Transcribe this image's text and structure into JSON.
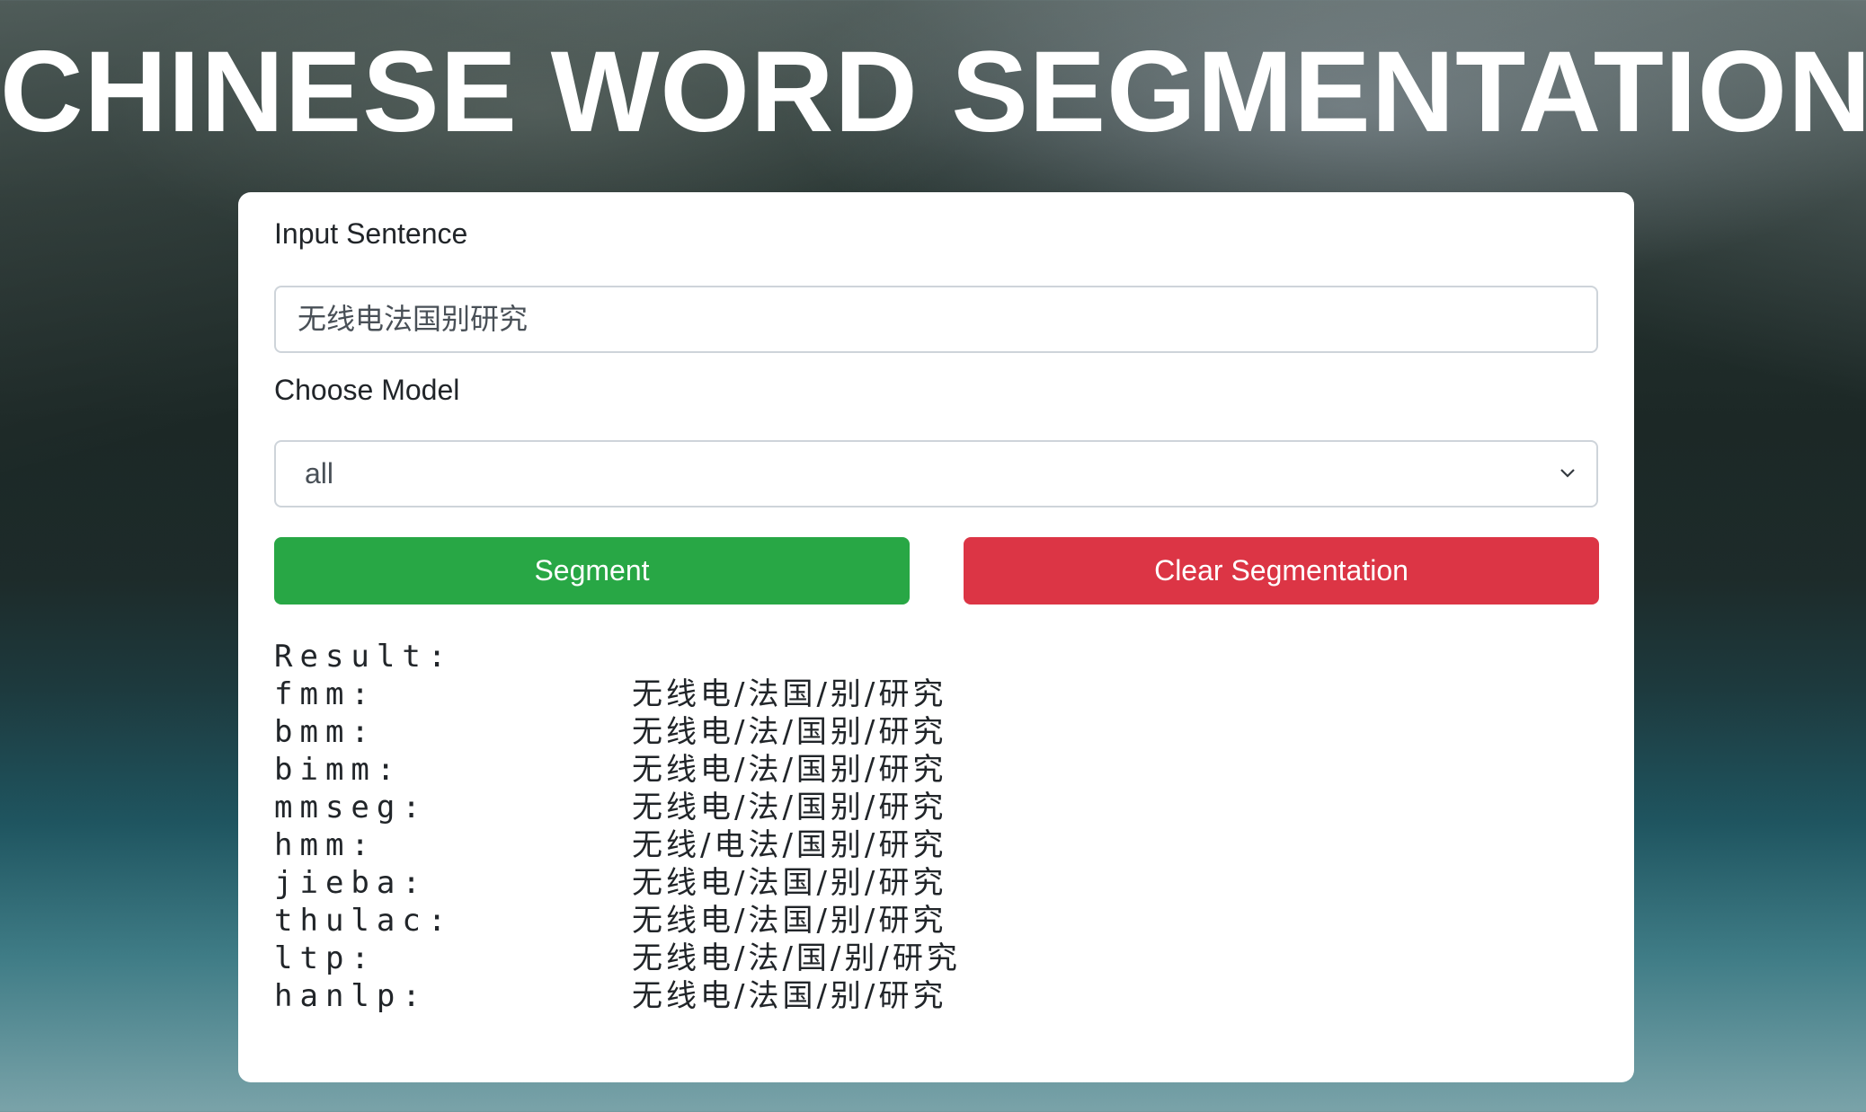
{
  "header": {
    "title": "CHINESE WORD SEGMENTATION"
  },
  "form": {
    "input_label": "Input Sentence",
    "input_value": "无线电法国别研究",
    "model_label": "Choose Model",
    "model_selected": "all",
    "segment_button": "Segment",
    "clear_button": "Clear Segmentation"
  },
  "result": {
    "heading": "Result:",
    "rows": [
      {
        "model": "fmm:",
        "segmentation": "无线电/法国/别/研究"
      },
      {
        "model": "bmm:",
        "segmentation": "无线电/法/国别/研究"
      },
      {
        "model": "bimm:",
        "segmentation": "无线电/法/国别/研究"
      },
      {
        "model": "mmseg:",
        "segmentation": "无线电/法/国别/研究"
      },
      {
        "model": "hmm:",
        "segmentation": "无线/电法/国别/研究"
      },
      {
        "model": "jieba:",
        "segmentation": "无线电/法国/别/研究"
      },
      {
        "model": "thulac:",
        "segmentation": "无线电/法国/别/研究"
      },
      {
        "model": "ltp:",
        "segmentation": "无线电/法/国/别/研究"
      },
      {
        "model": "hanlp:",
        "segmentation": "无线电/法国/别/研究"
      }
    ]
  },
  "colors": {
    "segment_button": "#28a745",
    "clear_button": "#dc3545",
    "card": "#ffffff"
  },
  "icons": {
    "select_arrow": "chevron-down-icon"
  }
}
